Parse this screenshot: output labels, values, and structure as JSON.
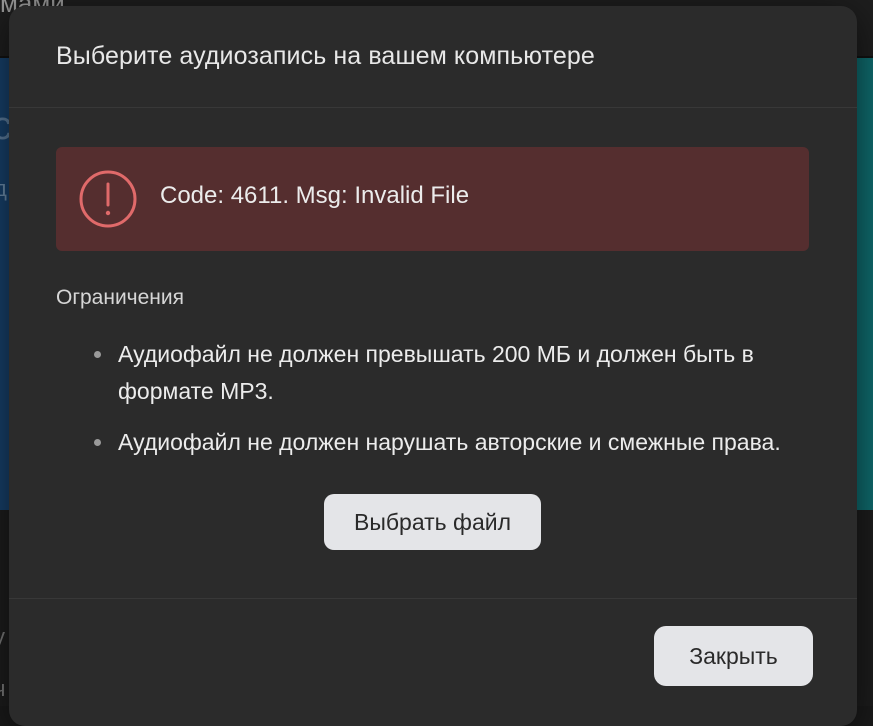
{
  "background": {
    "top_fragment": "мами",
    "left_fragments": [
      "с",
      "д",
      "у",
      "ч"
    ]
  },
  "modal": {
    "title": "Выберите аудиозапись на вашем компьютере",
    "error": {
      "icon": "exclamation-circle-icon",
      "message": "Code: 4611. Msg: Invalid File"
    },
    "restrictions": {
      "title": "Ограничения",
      "items": [
        "Аудиофайл не должен превышать 200 МБ и должен быть в формате MP3.",
        "Аудиофайл не должен нарушать авторские и смежные права."
      ]
    },
    "choose_file_label": "Выбрать файл",
    "close_label": "Закрыть"
  },
  "colors": {
    "modal_bg": "#2b2b2b",
    "error_bg": "#552e2f",
    "error_icon": "#e06a6a",
    "button_bg": "#e4e5e8"
  }
}
